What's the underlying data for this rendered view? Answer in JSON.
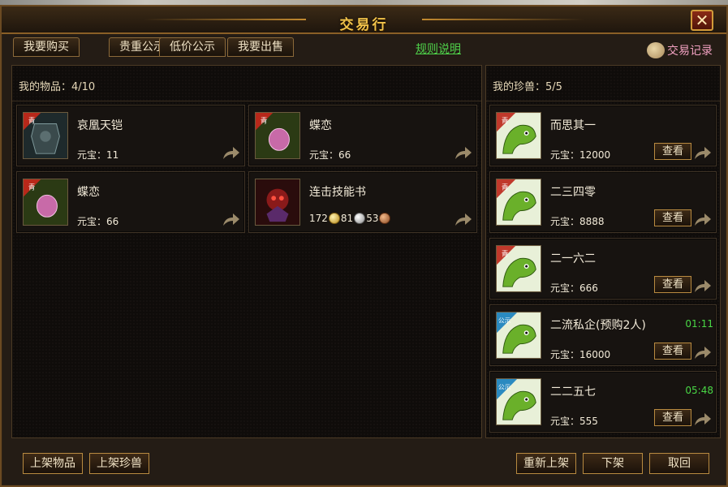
{
  "window": {
    "title": "交易行",
    "close_label": "✕"
  },
  "tabs": [
    {
      "label": "我要购买"
    },
    {
      "label": "贵重公示"
    },
    {
      "label": "低价公示"
    },
    {
      "label": "我要出售"
    }
  ],
  "rules_link": "规则说明",
  "trade_record": "交易记录",
  "my_items": {
    "header": "我的物品：4/10",
    "price_label": "元宝：",
    "items": [
      {
        "name": "哀凰天铠",
        "price": "11",
        "icon": "armor-icon",
        "badge": "青"
      },
      {
        "name": "蝶恋",
        "price": "66",
        "icon": "gem-icon",
        "badge": "青"
      },
      {
        "name": "蝶恋",
        "price": "66",
        "icon": "gem-icon",
        "badge": "青"
      },
      {
        "name": "连击技能书",
        "coins": [
          "172",
          "81",
          "53"
        ],
        "icon": "skill-book-icon"
      }
    ]
  },
  "my_pets": {
    "header": "我的珍兽：5/5",
    "price_label": "元宝：",
    "view_label": "查看",
    "pets": [
      {
        "name": "而思其一",
        "price": "12000",
        "badge": "青",
        "badge_color": "#c0392b",
        "timer": ""
      },
      {
        "name": "二三四零",
        "price": "8888",
        "badge": "青",
        "badge_color": "#c0392b",
        "timer": ""
      },
      {
        "name": "二一六二",
        "price": "666",
        "badge": "青",
        "badge_color": "#c0392b",
        "timer": ""
      },
      {
        "name": "二流私企(预购2人)",
        "price": "16000",
        "badge": "公示",
        "badge_color": "#2a8ac0",
        "timer": "01:11"
      },
      {
        "name": "二二五七",
        "price": "555",
        "badge": "公示",
        "badge_color": "#2a8ac0",
        "timer": "05:48"
      }
    ]
  },
  "buttons": {
    "list_item": "上架物品",
    "list_pet": "上架珍兽",
    "relist": "重新上架",
    "delist": "下架",
    "cancel": "取回"
  },
  "colors": {
    "accent": "#f0c24a",
    "green_text": "#49d845",
    "link": "#4fd24a"
  }
}
